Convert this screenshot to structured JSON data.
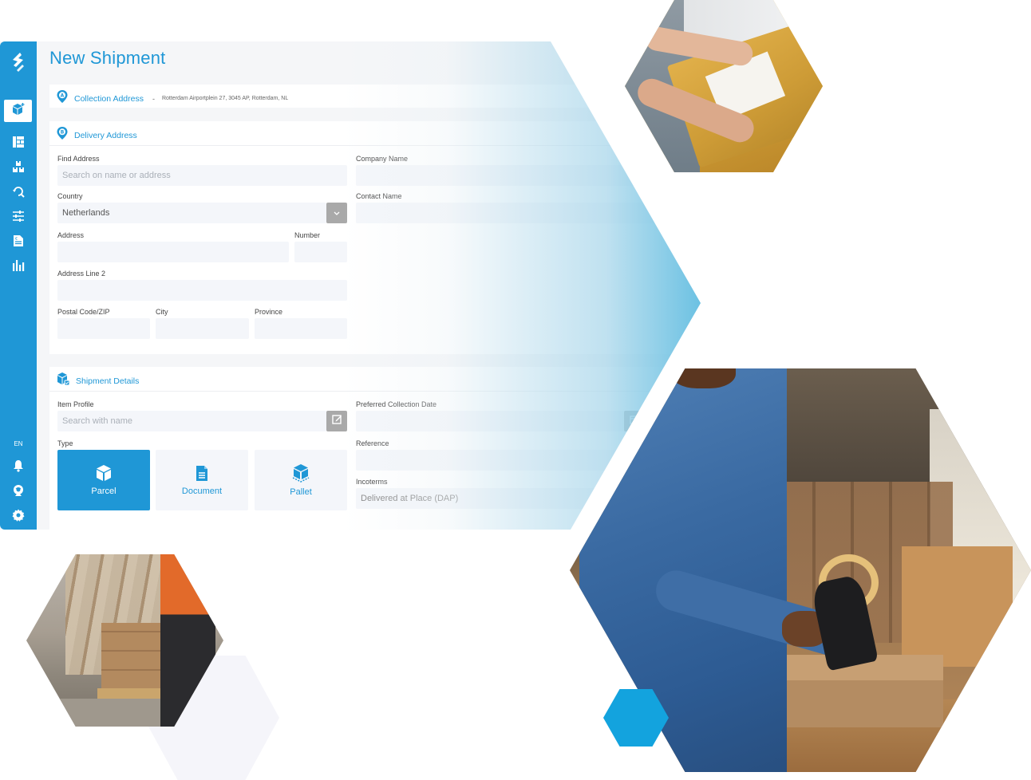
{
  "app": {
    "page_title": "New Shipment",
    "brand_color": "#1f97d6",
    "language": "EN"
  },
  "sidebar": {
    "items": [
      {
        "name": "new-shipment",
        "icon": "box-plus-icon",
        "active": true
      },
      {
        "name": "dashboard",
        "icon": "dashboard-icon",
        "active": false
      },
      {
        "name": "shipments",
        "icon": "boxes-icon",
        "active": false
      },
      {
        "name": "tracking",
        "icon": "search-refresh-icon",
        "active": false
      },
      {
        "name": "settings-sliders",
        "icon": "sliders-icon",
        "active": false
      },
      {
        "name": "invoices",
        "icon": "document-euro-icon",
        "active": false
      },
      {
        "name": "reports",
        "icon": "bar-chart-icon",
        "active": false
      }
    ],
    "bottom": [
      {
        "name": "notifications",
        "icon": "bell-icon"
      },
      {
        "name": "support",
        "icon": "headset-icon"
      },
      {
        "name": "settings",
        "icon": "gear-icon"
      }
    ]
  },
  "collection": {
    "title": "Collection Address",
    "marker": "A",
    "address": "Rotterdam Airportplein 27, 3045 AP, Rotterdam, NL"
  },
  "delivery": {
    "title": "Delivery Address",
    "marker": "B",
    "fields": {
      "find_address": {
        "label": "Find Address",
        "placeholder": "Search on name or address",
        "value": ""
      },
      "country": {
        "label": "Country",
        "value": "Netherlands"
      },
      "address": {
        "label": "Address",
        "value": ""
      },
      "number": {
        "label": "Number",
        "value": ""
      },
      "address_line2": {
        "label": "Address Line 2",
        "value": ""
      },
      "postal_code": {
        "label": "Postal Code/ZIP",
        "value": ""
      },
      "city": {
        "label": "City",
        "value": ""
      },
      "province": {
        "label": "Province",
        "value": ""
      },
      "company_name": {
        "label": "Company Name",
        "value": ""
      },
      "contact_name": {
        "label": "Contact Name",
        "value": ""
      }
    }
  },
  "shipment": {
    "title": "Shipment Details",
    "fields": {
      "item_profile": {
        "label": "Item Profile",
        "placeholder": "Search with name",
        "value": ""
      },
      "type": {
        "label": "Type",
        "options": [
          "Parcel",
          "Document",
          "Pallet"
        ],
        "selected": "Parcel"
      },
      "preferred_collection_date": {
        "label": "Preferred Collection Date",
        "value": ""
      },
      "reference": {
        "label": "Reference",
        "value": ""
      },
      "incoterms": {
        "label": "Incoterms",
        "value": "Delivered at Place (DAP)"
      }
    }
  },
  "decor": {
    "photos": [
      {
        "name": "photo-parcel-handover",
        "subject": "hands holding yellow padded envelope with shipping label"
      },
      {
        "name": "photo-warehouse",
        "subject": "workers moving pallet of boxes in warehouse"
      },
      {
        "name": "photo-packing",
        "subject": "person in denim shirt taping cardboard box"
      }
    ],
    "accent_color": "#13a3de"
  }
}
